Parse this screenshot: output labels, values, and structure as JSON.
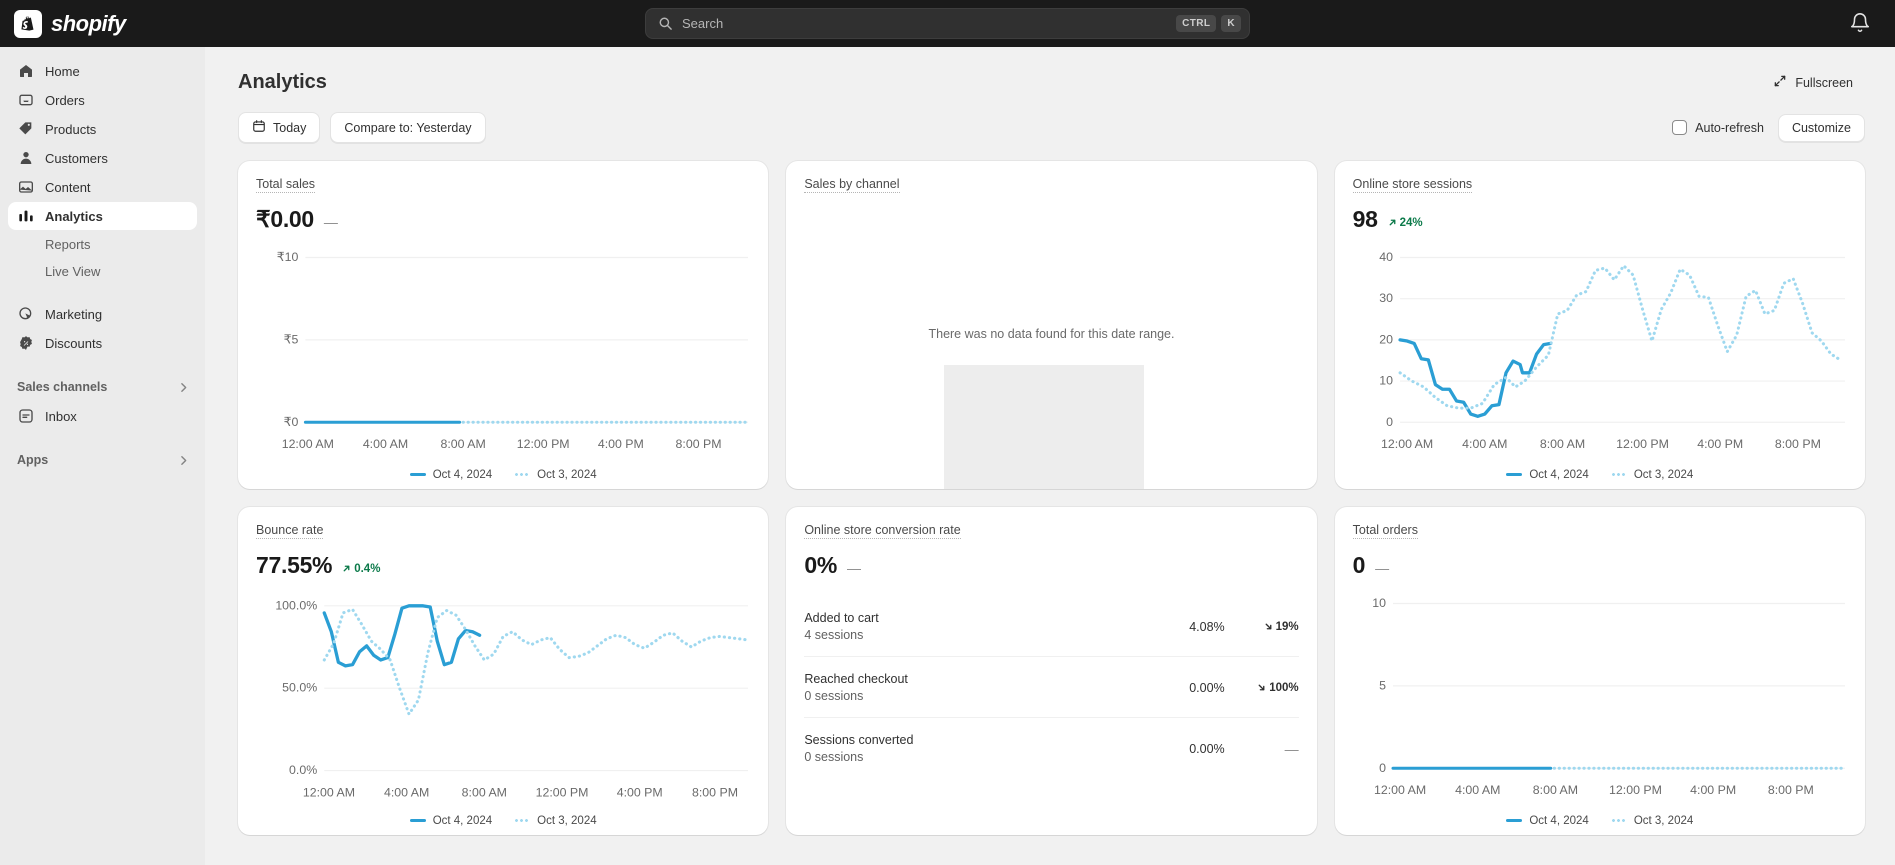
{
  "topbar": {
    "brand_name": "shopify",
    "brand_icon": "shopify-bag-icon",
    "search": {
      "placeholder": "Search",
      "icon": "search-icon",
      "shortcut_ctrl": "CTRL",
      "shortcut_key": "K"
    },
    "notifications_icon": "bell-icon"
  },
  "sidebar": {
    "items": [
      {
        "label": "Home",
        "icon": "home-icon",
        "active": false
      },
      {
        "label": "Orders",
        "icon": "orders-inbox-icon",
        "active": false
      },
      {
        "label": "Products",
        "icon": "products-tag-icon",
        "active": false
      },
      {
        "label": "Customers",
        "icon": "customers-person-icon",
        "active": false
      },
      {
        "label": "Content",
        "icon": "content-image-icon",
        "active": false
      },
      {
        "label": "Analytics",
        "icon": "analytics-bars-icon",
        "active": true
      }
    ],
    "sub_items": [
      {
        "label": "Reports"
      },
      {
        "label": "Live View"
      }
    ],
    "items_lower": [
      {
        "label": "Marketing",
        "icon": "marketing-target-icon"
      },
      {
        "label": "Discounts",
        "icon": "discounts-badge-icon"
      }
    ],
    "sections": [
      {
        "label": "Sales channels",
        "icon": "chevron-right-icon"
      },
      {
        "label": "Apps",
        "icon": "chevron-right-icon"
      }
    ],
    "inbox": {
      "label": "Inbox",
      "icon": "inbox-chat-icon"
    }
  },
  "header": {
    "title": "Analytics",
    "fullscreen_label": "Fullscreen",
    "fullscreen_icon": "expand-arrows-icon"
  },
  "filters": {
    "date_range": {
      "label": "Today",
      "icon": "calendar-icon"
    },
    "compare": {
      "label": "Compare to: Yesterday"
    },
    "auto_refresh": {
      "label": "Auto-refresh",
      "checked": false
    },
    "customize": {
      "label": "Customize"
    }
  },
  "legend": {
    "primary": "Oct 4, 2024",
    "comparison": "Oct 3, 2024"
  },
  "colors": {
    "primary_line": "#2a9ed4",
    "comparison_line": "#9fd8ef",
    "positive": "#0c7a4a",
    "neutral": "#8a8a8a"
  },
  "cards": {
    "total_sales": {
      "title": "Total sales",
      "value": "₹0.00",
      "delta": "—",
      "delta_dir": "flat"
    },
    "sales_by_channel": {
      "title": "Sales by channel",
      "empty_message": "There was no data found for this date range."
    },
    "online_store_sessions": {
      "title": "Online store sessions",
      "value": "98",
      "delta": "24%",
      "delta_dir": "up"
    },
    "bounce_rate": {
      "title": "Bounce rate",
      "value": "77.55%",
      "delta": "0.4%",
      "delta_dir": "up"
    },
    "conversion_rate": {
      "title": "Online store conversion rate",
      "value": "0%",
      "delta": "—",
      "delta_dir": "flat",
      "rows": [
        {
          "label": "Added to cart",
          "sessions": "4 sessions",
          "pct": "4.08%",
          "delta": "19%",
          "delta_dir": "down"
        },
        {
          "label": "Reached checkout",
          "sessions": "0 sessions",
          "pct": "0.00%",
          "delta": "100%",
          "delta_dir": "down"
        },
        {
          "label": "Sessions converted",
          "sessions": "0 sessions",
          "pct": "0.00%",
          "delta": "—",
          "delta_dir": "none"
        }
      ]
    },
    "total_orders": {
      "title": "Total orders",
      "value": "0",
      "delta": "—",
      "delta_dir": "flat"
    }
  },
  "chart_data": [
    {
      "id": "total_sales",
      "type": "line",
      "title": "Total sales",
      "xlabel": "",
      "ylabel": "",
      "ylim": [
        0,
        10
      ],
      "yticks": [
        "₹0",
        "₹5",
        "₹10"
      ],
      "ytick_values": [
        0,
        5,
        10
      ],
      "xticks": [
        "12:00 AM",
        "4:00 AM",
        "8:00 AM",
        "12:00 PM",
        "4:00 PM",
        "8:00 PM"
      ],
      "grid": true,
      "legend_position": "bottom",
      "series": [
        {
          "name": "Oct 4, 2024",
          "style": "solid",
          "x_end_fraction": 0.35,
          "values": [
            0,
            0,
            0,
            0,
            0,
            0,
            0,
            0,
            0
          ]
        },
        {
          "name": "Oct 3, 2024",
          "style": "dotted",
          "values": [
            0,
            0,
            0,
            0,
            0,
            0,
            0,
            0,
            0,
            0,
            0,
            0,
            0,
            0,
            0,
            0,
            0,
            0,
            0,
            0,
            0,
            0,
            0,
            0
          ]
        }
      ]
    },
    {
      "id": "online_store_sessions",
      "type": "line",
      "title": "Online store sessions",
      "xlabel": "",
      "ylabel": "",
      "ylim": [
        0,
        40
      ],
      "yticks": [
        "0",
        "10",
        "20",
        "30",
        "40"
      ],
      "ytick_values": [
        0,
        10,
        20,
        30,
        40
      ],
      "xticks": [
        "12:00 AM",
        "4:00 AM",
        "8:00 AM",
        "12:00 PM",
        "4:00 PM",
        "8:00 PM"
      ],
      "grid": true,
      "legend_position": "bottom",
      "series": [
        {
          "name": "Oct 4, 2024",
          "style": "solid",
          "x_end_fraction": 0.35,
          "values": [
            20,
            19,
            15,
            15,
            9,
            7,
            7,
            5,
            3,
            3,
            1,
            1,
            2,
            4,
            4,
            11,
            15,
            14,
            12,
            12,
            16,
            19
          ]
        },
        {
          "name": "Oct 3, 2024",
          "style": "dotted",
          "values": [
            12,
            10,
            9,
            7,
            5,
            4,
            3,
            3,
            3,
            4,
            9,
            11,
            9,
            12,
            16,
            22,
            26,
            27,
            31,
            31,
            36,
            39,
            36,
            38,
            40,
            38,
            28,
            20,
            26,
            31,
            39,
            37,
            30,
            30,
            22,
            16,
            25,
            31,
            25,
            26,
            33,
            35,
            30,
            22,
            18,
            17,
            14
          ]
        }
      ]
    },
    {
      "id": "bounce_rate",
      "type": "line",
      "title": "Bounce rate",
      "xlabel": "",
      "ylabel": "",
      "ylim": [
        0,
        100
      ],
      "yticks": [
        "0.0%",
        "50.0%",
        "100.0%"
      ],
      "ytick_values": [
        0,
        50,
        100
      ],
      "xticks": [
        "12:00 AM",
        "4:00 AM",
        "8:00 AM",
        "12:00 PM",
        "4:00 PM",
        "8:00 PM"
      ],
      "grid": true,
      "legend_position": "bottom",
      "series": [
        {
          "name": "Oct 4, 2024",
          "style": "solid",
          "x_end_fraction": 0.35,
          "values": [
            96,
            80,
            64,
            63,
            70,
            73,
            68,
            67,
            78,
            100,
            100,
            100,
            100,
            82,
            60,
            61,
            76,
            81,
            79,
            78
          ]
        },
        {
          "name": "Oct 3, 2024",
          "style": "dotted",
          "values": [
            67,
            78,
            95,
            99,
            88,
            76,
            72,
            66,
            50,
            36,
            44,
            70,
            89,
            95,
            93,
            86,
            76,
            68,
            72,
            82,
            84,
            79,
            77,
            80,
            81,
            73,
            69,
            70,
            72,
            75,
            78,
            80,
            79,
            75,
            73,
            76,
            80,
            81,
            76,
            74,
            77,
            79,
            79,
            78
          ]
        }
      ]
    },
    {
      "id": "total_orders",
      "type": "line",
      "title": "Total orders",
      "xlabel": "",
      "ylabel": "",
      "ylim": [
        0,
        10
      ],
      "yticks": [
        "0",
        "5",
        "10"
      ],
      "ytick_values": [
        0,
        5,
        10
      ],
      "xticks": [
        "12:00 AM",
        "4:00 AM",
        "8:00 AM",
        "12:00 PM",
        "4:00 PM",
        "8:00 PM"
      ],
      "grid": true,
      "legend_position": "bottom",
      "series": [
        {
          "name": "Oct 4, 2024",
          "style": "solid",
          "x_end_fraction": 0.35,
          "values": [
            0,
            0,
            0,
            0,
            0,
            0,
            0,
            0,
            0
          ]
        },
        {
          "name": "Oct 3, 2024",
          "style": "dotted",
          "values": [
            0,
            0,
            0,
            0,
            0,
            0,
            0,
            0,
            0,
            0,
            0,
            0,
            0,
            0,
            0,
            0,
            0,
            0,
            0,
            0,
            0,
            0,
            0,
            0
          ]
        }
      ]
    }
  ]
}
